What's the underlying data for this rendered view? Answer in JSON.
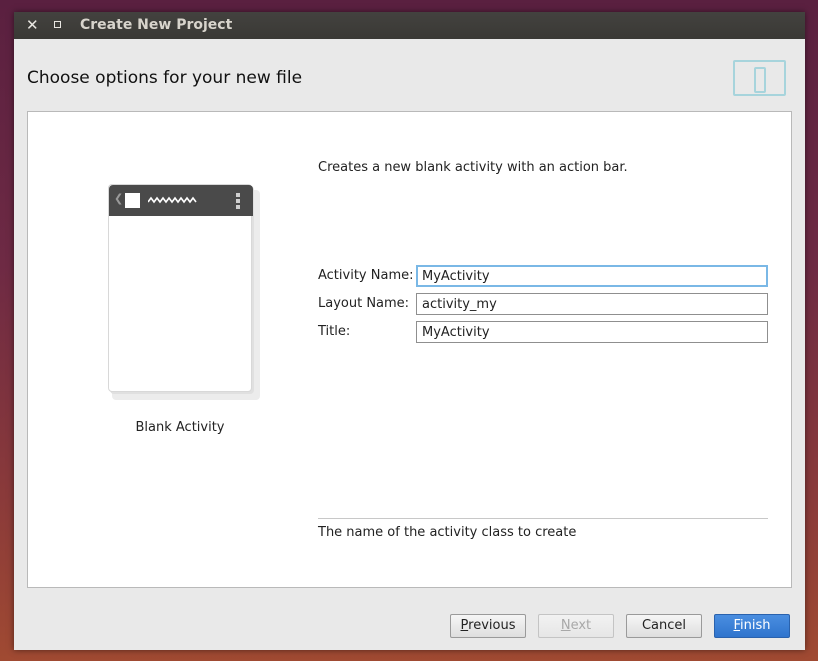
{
  "window": {
    "title": "Create New Project",
    "close_glyph": "✕"
  },
  "header": {
    "title": "Choose options for your new file",
    "icon": "device-layout-icon",
    "icon_color": "#a7d4dc"
  },
  "preview": {
    "label": "Blank Activity"
  },
  "description": "Creates a new blank activity with an action bar.",
  "form": {
    "fields": [
      {
        "label": "Activity Name:",
        "value": "MyActivity",
        "focused": true
      },
      {
        "label": "Layout Name:",
        "value": "activity_my",
        "focused": false
      },
      {
        "label": "Title:",
        "value": "MyActivity",
        "focused": false
      }
    ]
  },
  "help_text": "The name of the activity class to create",
  "buttons": {
    "previous": "Previous",
    "next": "Next",
    "cancel": "Cancel",
    "finish": "Finish"
  },
  "colors": {
    "primary_button": "#2f74cd",
    "focus_border": "#7ab8e6"
  }
}
